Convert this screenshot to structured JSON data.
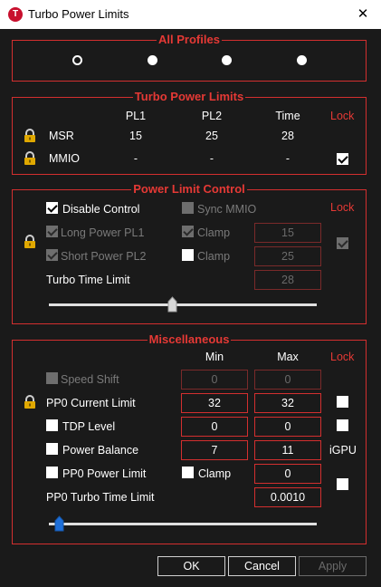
{
  "window": {
    "title": "Turbo Power Limits",
    "close_glyph": "✕",
    "app_icon_letter": "T"
  },
  "profiles": {
    "title": "All Profiles",
    "count": 4,
    "selected_index": 0
  },
  "turbo": {
    "title": "Turbo Power Limits",
    "headers": {
      "pl1": "PL1",
      "pl2": "PL2",
      "time": "Time",
      "lock": "Lock"
    },
    "rows": [
      {
        "label": "MSR",
        "pl1": "15",
        "pl2": "25",
        "time": "28"
      },
      {
        "label": "MMIO",
        "pl1": "-",
        "pl2": "-",
        "time": "-"
      }
    ],
    "mmio_lock_checked": true
  },
  "plc": {
    "title": "Power Limit Control",
    "lock_label": "Lock",
    "disable_control": {
      "label": "Disable Control",
      "checked": true
    },
    "sync_mmio": {
      "label": "Sync MMIO",
      "checked": false
    },
    "long_power": {
      "label": "Long Power PL1",
      "checked": true
    },
    "clamp1": {
      "label": "Clamp",
      "checked": true
    },
    "pl1_value": "15",
    "short_power": {
      "label": "Short Power PL2",
      "checked": true
    },
    "clamp2": {
      "label": "Clamp",
      "checked": false
    },
    "pl2_value": "25",
    "turbo_time_label": "Turbo Time Limit",
    "turbo_time_value": "28",
    "lock_checked": true,
    "slider_fraction": 0.46
  },
  "misc": {
    "title": "Miscellaneous",
    "headers": {
      "min": "Min",
      "max": "Max",
      "lock": "Lock"
    },
    "speed_shift": {
      "label": "Speed Shift",
      "min": "0",
      "max": "0"
    },
    "pp0_current": {
      "label": "PP0 Current Limit",
      "min": "32",
      "max": "32"
    },
    "tdp_level": {
      "label": "TDP Level",
      "min": "0",
      "max": "0"
    },
    "power_balance": {
      "label": "Power Balance",
      "min": "7",
      "max": "11",
      "igpu": "iGPU"
    },
    "pp0_power": {
      "label": "PP0 Power Limit",
      "clamp_label": "Clamp",
      "max": "0"
    },
    "pp0_turbo": {
      "label": "PP0 Turbo Time Limit",
      "value": "0.0010"
    },
    "slider_fraction": 0.02
  },
  "buttons": {
    "ok": "OK",
    "cancel": "Cancel",
    "apply": "Apply"
  }
}
